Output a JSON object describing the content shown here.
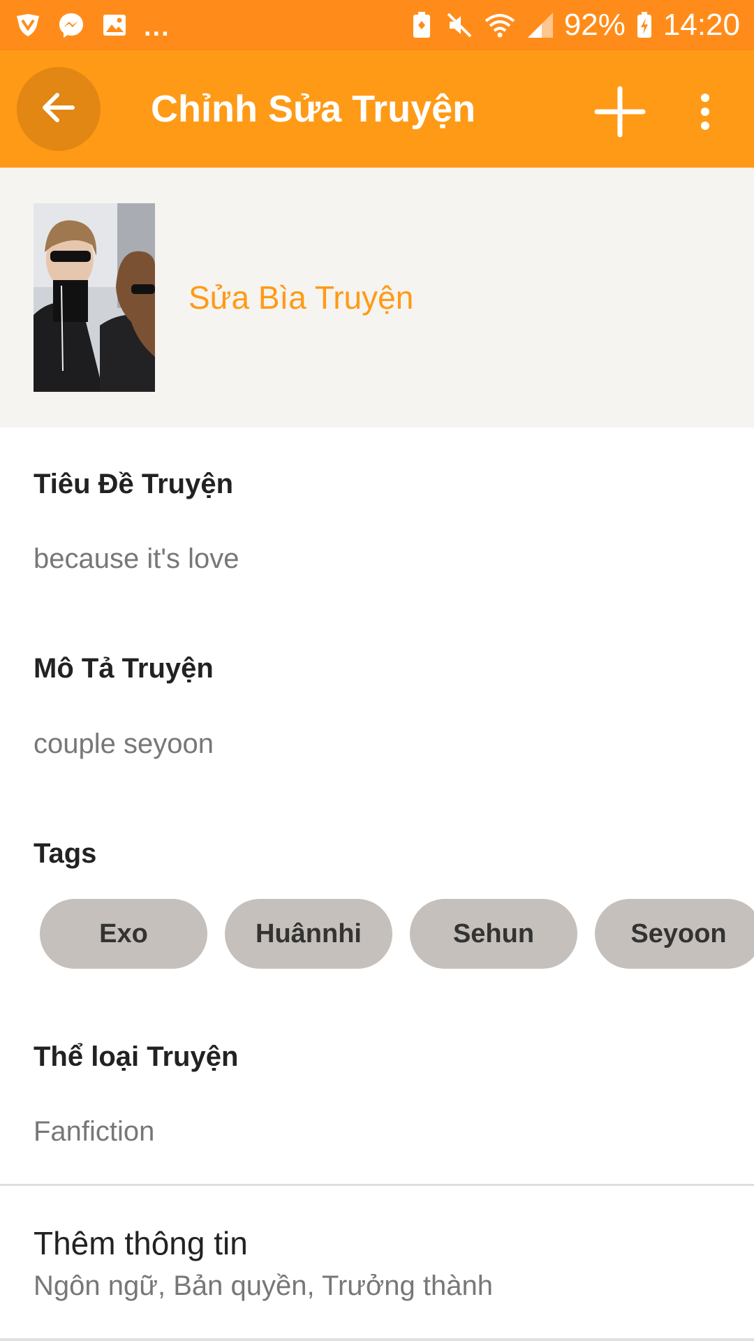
{
  "status_bar": {
    "dots": "...",
    "battery": "92%",
    "time": "14:20"
  },
  "app_bar": {
    "title": "Chỉnh Sửa Truyện"
  },
  "cover": {
    "edit_label": "Sửa Bìa Truyện"
  },
  "fields": {
    "title_label": "Tiêu Đề Truyện",
    "title_value": "because it's love",
    "description_label": "Mô Tả Truyện",
    "description_value": "couple seyoon",
    "tags_label": "Tags",
    "tags": [
      "Exo",
      "Huânnhi",
      "Sehun",
      "Seyoon"
    ],
    "category_label": "Thể loại Truyện",
    "category_value": "Fanfiction"
  },
  "more_info": {
    "title": "Thêm thông tin",
    "subtitle": "Ngôn ngữ, Bản quyền, Trưởng thành"
  },
  "colors": {
    "status_bar": "#ff8c1a",
    "app_bar": "#ff9a16",
    "accent": "#ff9a16",
    "tag_chip": "#c5c0bb"
  }
}
